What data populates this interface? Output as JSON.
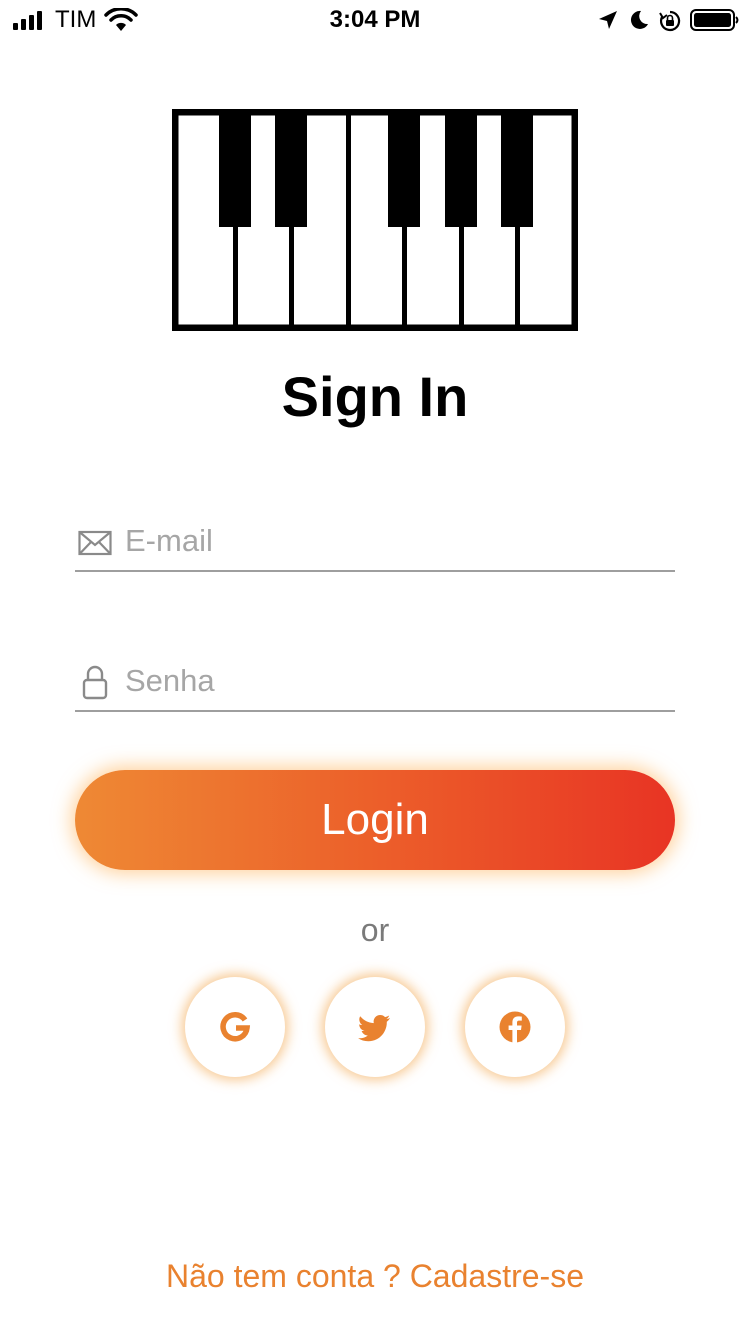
{
  "status_bar": {
    "carrier": "TIM",
    "time": "3:04 PM"
  },
  "logo": {
    "icon": "piano-keyboard-icon"
  },
  "title": "Sign In",
  "form": {
    "email_placeholder": "E-mail",
    "email_value": "",
    "password_placeholder": "Senha",
    "password_value": "",
    "login_label": "Login"
  },
  "divider_text": "or",
  "social": [
    {
      "name": "google",
      "icon": "google-icon"
    },
    {
      "name": "twitter",
      "icon": "twitter-icon"
    },
    {
      "name": "facebook",
      "icon": "facebook-icon"
    }
  ],
  "signup_text": "Não tem conta ? Cadastre-se",
  "colors": {
    "accent": "#e9822f",
    "gradient_start": "#ee8934",
    "gradient_end": "#e83424",
    "placeholder": "#a6a6a6"
  }
}
